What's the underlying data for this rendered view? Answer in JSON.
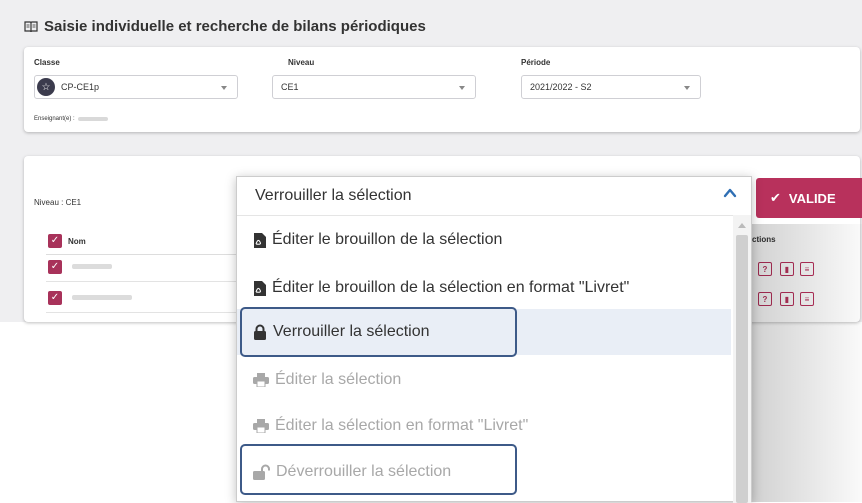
{
  "page": {
    "title": "Saisie individuelle et recherche de bilans périodiques"
  },
  "filters": {
    "classe": {
      "label": "Classe",
      "value": "CP-CE1p"
    },
    "niveau": {
      "label": "Niveau",
      "value": "CE1"
    },
    "periode": {
      "label": "Période",
      "value": "2021/2022 - S2"
    },
    "teacher_label": "Enseignant(e) :"
  },
  "list": {
    "niveau_text": "Niveau : CE1",
    "column_nom": "Nom",
    "column_actions": "ctions"
  },
  "valider_label": "VALIDE",
  "dropdown": {
    "selected": "Verrouiller la sélection",
    "items": [
      {
        "label": "Éditer le brouillon de la sélection",
        "icon": "pdf-icon",
        "disabled": false
      },
      {
        "label": "Éditer le brouillon de la sélection en format \"Livret\"",
        "icon": "pdf-icon",
        "disabled": false
      },
      {
        "label": "Verrouiller la sélection",
        "icon": "lock-icon",
        "disabled": false,
        "active": true
      },
      {
        "label": "Éditer la sélection",
        "icon": "print-icon",
        "disabled": true
      },
      {
        "label": "Éditer la sélection en format \"Livret\"",
        "icon": "print-icon",
        "disabled": true
      },
      {
        "label": "Déverrouiller la sélection",
        "icon": "unlock-icon",
        "disabled": true
      }
    ]
  },
  "colors": {
    "accent": "#b8315c",
    "highlight_border": "#3d5a88",
    "active_bg": "#e9eef6"
  }
}
